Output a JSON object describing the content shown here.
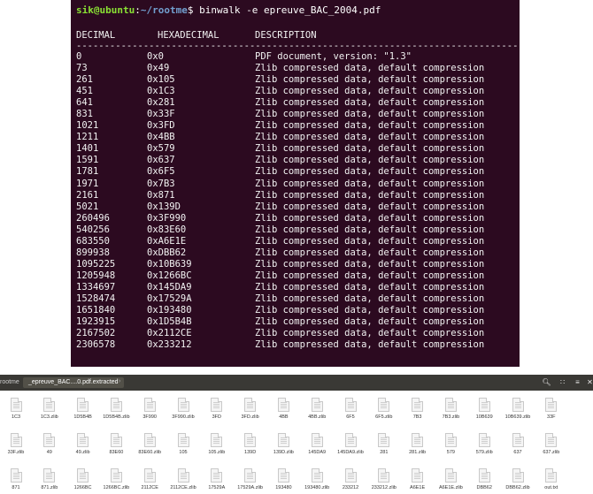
{
  "terminal": {
    "user_host": "sik@ubuntu",
    "path": "~/rootme",
    "command": "binwalk -e epreuve_BAC_2004.pdf",
    "headers": {
      "decimal": "DECIMAL",
      "hex": "HEXADECIMAL",
      "desc": "DESCRIPTION"
    },
    "separator": "--------------------------------------------------------------------------------",
    "rows": [
      [
        "0",
        "0x0",
        "PDF document, version: \"1.3\""
      ],
      [
        "73",
        "0x49",
        "Zlib compressed data, default compression"
      ],
      [
        "261",
        "0x105",
        "Zlib compressed data, default compression"
      ],
      [
        "451",
        "0x1C3",
        "Zlib compressed data, default compression"
      ],
      [
        "641",
        "0x281",
        "Zlib compressed data, default compression"
      ],
      [
        "831",
        "0x33F",
        "Zlib compressed data, default compression"
      ],
      [
        "1021",
        "0x3FD",
        "Zlib compressed data, default compression"
      ],
      [
        "1211",
        "0x4BB",
        "Zlib compressed data, default compression"
      ],
      [
        "1401",
        "0x579",
        "Zlib compressed data, default compression"
      ],
      [
        "1591",
        "0x637",
        "Zlib compressed data, default compression"
      ],
      [
        "1781",
        "0x6F5",
        "Zlib compressed data, default compression"
      ],
      [
        "1971",
        "0x7B3",
        "Zlib compressed data, default compression"
      ],
      [
        "2161",
        "0x871",
        "Zlib compressed data, default compression"
      ],
      [
        "5021",
        "0x139D",
        "Zlib compressed data, default compression"
      ],
      [
        "260496",
        "0x3F990",
        "Zlib compressed data, default compression"
      ],
      [
        "540256",
        "0x83E60",
        "Zlib compressed data, default compression"
      ],
      [
        "683550",
        "0xA6E1E",
        "Zlib compressed data, default compression"
      ],
      [
        "899938",
        "0xDBB62",
        "Zlib compressed data, default compression"
      ],
      [
        "1095225",
        "0x10B639",
        "Zlib compressed data, default compression"
      ],
      [
        "1205948",
        "0x1266BC",
        "Zlib compressed data, default compression"
      ],
      [
        "1334697",
        "0x145DA9",
        "Zlib compressed data, default compression"
      ],
      [
        "1528474",
        "0x17529A",
        "Zlib compressed data, default compression"
      ],
      [
        "1651840",
        "0x193480",
        "Zlib compressed data, default compression"
      ],
      [
        "1923915",
        "0x1D5B4B",
        "Zlib compressed data, default compression"
      ],
      [
        "2167502",
        "0x2112CE",
        "Zlib compressed data, default compression"
      ],
      [
        "2306578",
        "0x233212",
        "Zlib compressed data, default compression"
      ]
    ]
  },
  "file_manager": {
    "breadcrumb_prev": "rootme",
    "breadcrumb_current": "_epreuve_BAC....0.pdf.extracted",
    "breadcrumb_arrow": "›",
    "header_icons": [
      "search-icon",
      "view-toggle-icon",
      "menu-icon",
      "close-icon"
    ],
    "rows": [
      [
        "1C3",
        "1C3.zlib",
        "1D5B4B",
        "1D5B4B.zlib",
        "3F990",
        "3F990.zlib",
        "3FD",
        "3FD.zlib",
        "4BB",
        "4BB.zlib",
        "6F5",
        "6F5.zlib",
        "7B3",
        "7B3.zlib",
        "10B639",
        "10B639.zlib",
        "33F"
      ],
      [
        "33F.zlib",
        "49",
        "49.zlib",
        "83E60",
        "83E60.zlib",
        "105",
        "105.zlib",
        "139D",
        "139D.zlib",
        "145DA9",
        "145DA9.zlib",
        "281",
        "281.zlib",
        "579",
        "579.zlib",
        "637",
        "637.zlib"
      ],
      [
        "871",
        "871.zlib",
        "1266BC",
        "1266BC.zlib",
        "2112CE",
        "2112CE.zlib",
        "17529A",
        "17529A.zlib",
        "193480",
        "193480.zlib",
        "233212",
        "233212.zlib",
        "A6E1E",
        "A6E1E.zlib",
        "DBB62",
        "DBB62.zlib",
        "out.txt"
      ]
    ]
  },
  "colors": {
    "terminal_bg": "#2c0a20",
    "prompt_user": "#8ae234",
    "prompt_path": "#729fcf",
    "header_bar": "#3a3935"
  }
}
